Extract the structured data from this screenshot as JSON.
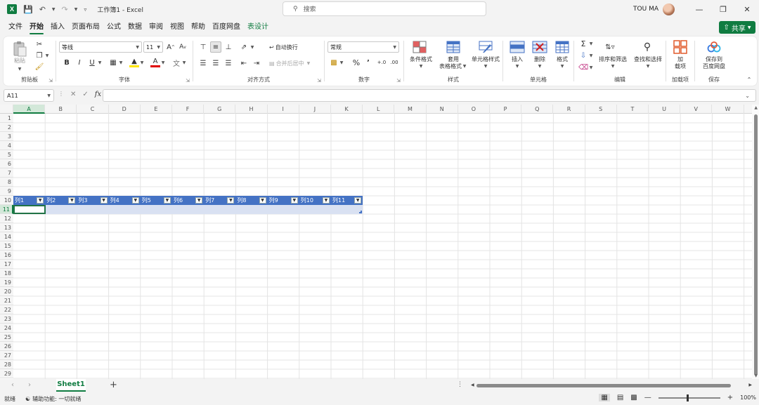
{
  "titlebar": {
    "app_logo": "X",
    "doc_title": "工作簿1 - Excel",
    "search_placeholder": "搜索",
    "user_name": "TOU MA",
    "icons": [
      "save-icon",
      "undo-icon",
      "redo-icon",
      "customize-icon",
      "search-icon",
      "minimize-icon",
      "restore-icon",
      "close-icon"
    ]
  },
  "menu": {
    "tabs": [
      {
        "label": "文件"
      },
      {
        "label": "开始"
      },
      {
        "label": "插入"
      },
      {
        "label": "页面布局"
      },
      {
        "label": "公式"
      },
      {
        "label": "数据"
      },
      {
        "label": "审阅"
      },
      {
        "label": "视图"
      },
      {
        "label": "帮助"
      },
      {
        "label": "百度网盘"
      },
      {
        "label": "表设计"
      }
    ],
    "active_index": 1,
    "share_label": "共享"
  },
  "ribbon": {
    "clipboard": {
      "label": "剪贴板",
      "paste": "粘贴"
    },
    "font": {
      "label": "字体",
      "font_name": "等线",
      "font_size": "11"
    },
    "alignment": {
      "label": "对齐方式",
      "wrap": "自动换行",
      "merge": "合并后居中"
    },
    "number": {
      "label": "数字",
      "format": "常规"
    },
    "styles": {
      "label": "样式",
      "conditional": "条件格式",
      "table_format_1": "套用",
      "table_format_2": "表格格式",
      "cell_styles": "单元格样式"
    },
    "cells": {
      "label": "单元格",
      "insert": "插入",
      "delete": "删除",
      "format": "格式"
    },
    "editing": {
      "label": "编辑",
      "sort": "排序和筛选",
      "find": "查找和选择"
    },
    "addins": {
      "label": "加载项",
      "btn_1": "加",
      "btn_2": "载项"
    },
    "save": {
      "label": "保存",
      "btn_1": "保存到",
      "btn_2": "百度网盘"
    }
  },
  "formula_bar": {
    "name_box": "A11",
    "fx": "fx",
    "value": ""
  },
  "grid": {
    "columns": [
      "A",
      "B",
      "C",
      "D",
      "E",
      "F",
      "G",
      "H",
      "I",
      "J",
      "K",
      "L",
      "M",
      "N",
      "O",
      "P",
      "Q",
      "R",
      "S",
      "T",
      "U",
      "V",
      "W"
    ],
    "rows": [
      "1",
      "2",
      "3",
      "4",
      "5",
      "6",
      "7",
      "8",
      "9",
      "10",
      "11",
      "12",
      "13",
      "14",
      "15",
      "16",
      "17",
      "18",
      "19",
      "20",
      "21",
      "22",
      "23",
      "24",
      "25",
      "26",
      "27",
      "28",
      "29"
    ],
    "selected_col": "A",
    "selected_row": "11",
    "table_headers": [
      "列1",
      "列2",
      "列3",
      "列4",
      "列5",
      "列6",
      "列7",
      "列8",
      "列9",
      "列10",
      "列11"
    ],
    "table_header_color": "#4472c4",
    "table_band_color": "#d9e1f2"
  },
  "sheets": {
    "tabs": [
      {
        "label": "Sheet1"
      }
    ],
    "add": "+"
  },
  "status": {
    "ready": "就绪",
    "accessibility": "辅助功能: 一切就绪",
    "zoom": "100%"
  },
  "colors": {
    "accent": "#107c41"
  }
}
